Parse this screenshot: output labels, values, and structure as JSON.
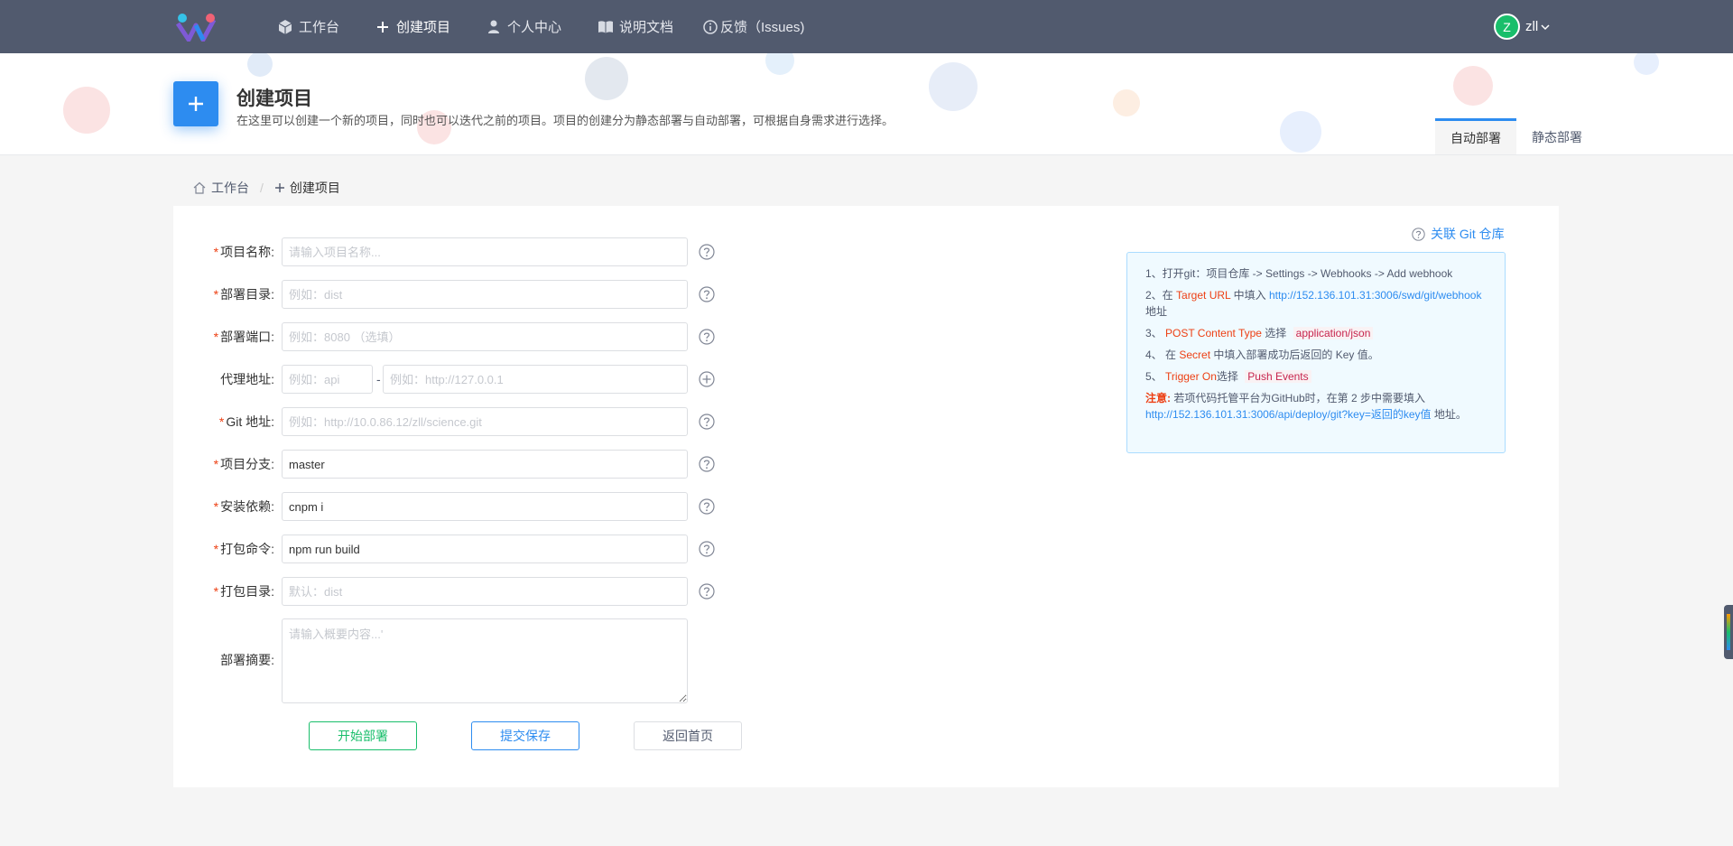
{
  "nav": {
    "items": [
      {
        "label": "工作台",
        "icon": "cube-icon"
      },
      {
        "label": "创建项目",
        "icon": "plus-icon"
      },
      {
        "label": "个人中心",
        "icon": "person-icon"
      },
      {
        "label": "说明文档",
        "icon": "book-icon"
      },
      {
        "label": "反馈（Issues)",
        "icon": "info-icon"
      }
    ],
    "user": {
      "avatar_letter": "Z",
      "name": "zll"
    }
  },
  "header": {
    "title": "创建项目",
    "description": "在这里可以创建一个新的项目，同时也可以迭代之前的项目。项目的创建分为静态部署与自动部署，可根据自身需求进行选择。",
    "tabs": [
      {
        "label": "自动部署",
        "active": true
      },
      {
        "label": "静态部署",
        "active": false
      }
    ]
  },
  "breadcrumb": {
    "home": "工作台",
    "current": "创建项目"
  },
  "form": {
    "project_name": {
      "label": "项目名称:",
      "placeholder": "请输入项目名称...",
      "value": ""
    },
    "deploy_dir": {
      "label": "部署目录:",
      "placeholder": "例如：dist",
      "value": ""
    },
    "deploy_port": {
      "label": "部署端口:",
      "placeholder": "例如：8080 （选填）",
      "value": ""
    },
    "proxy": {
      "label": "代理地址:",
      "path_placeholder": "例如：api",
      "sep": "-",
      "target_placeholder": "例如：http://127.0.0.1"
    },
    "git_url": {
      "label": "Git 地址:",
      "placeholder": "例如：http://10.0.86.12/zll/science.git",
      "value": ""
    },
    "branch": {
      "label": "项目分支:",
      "value": "master"
    },
    "install": {
      "label": "安装依赖:",
      "value": "cnpm i"
    },
    "build_cmd": {
      "label": "打包命令:",
      "value": "npm run build"
    },
    "build_dir": {
      "label": "打包目录:",
      "placeholder": "默认：dist",
      "value": ""
    },
    "summary": {
      "label": "部署摘要:",
      "placeholder": "请输入概要内容...'"
    }
  },
  "buttons": {
    "start": "开始部署",
    "save": "提交保存",
    "back": "返回首页"
  },
  "git_link": "关联 Git 仓库",
  "help": {
    "step1": "1、打开git：项目仓库 -> Settings -> Webhooks -> Add webhook",
    "step2_a": "2、在 ",
    "step2_target": "Target URL",
    "step2_b": " 中填入 ",
    "step2_url": "http://152.136.101.31:3006/swd/git/webhook",
    "step2_c": " 地址",
    "step3_a": "3、 ",
    "step3_key": "POST Content Type",
    "step3_b": " 选择 ",
    "step3_code": "application/json",
    "step4_a": "4、 在 ",
    "step4_key": "Secret",
    "step4_b": " 中填入部署成功后返回的 Key 值。",
    "step5_a": "5、 ",
    "step5_key": "Trigger On",
    "step5_b": "选择 ",
    "step5_code": "Push Events",
    "note_label": "注意:",
    "note_a": " 若项代码托管平台为GitHub时，在第 2 步中需要填入",
    "note_url": "http://152.136.101.31:3006/api/deploy/git?key=返回的key值",
    "note_b": " 地址。"
  },
  "colors": {
    "primary": "#2d8cf0",
    "success": "#19be6b",
    "error": "#ed4014",
    "nav_bg": "#515a6e"
  }
}
